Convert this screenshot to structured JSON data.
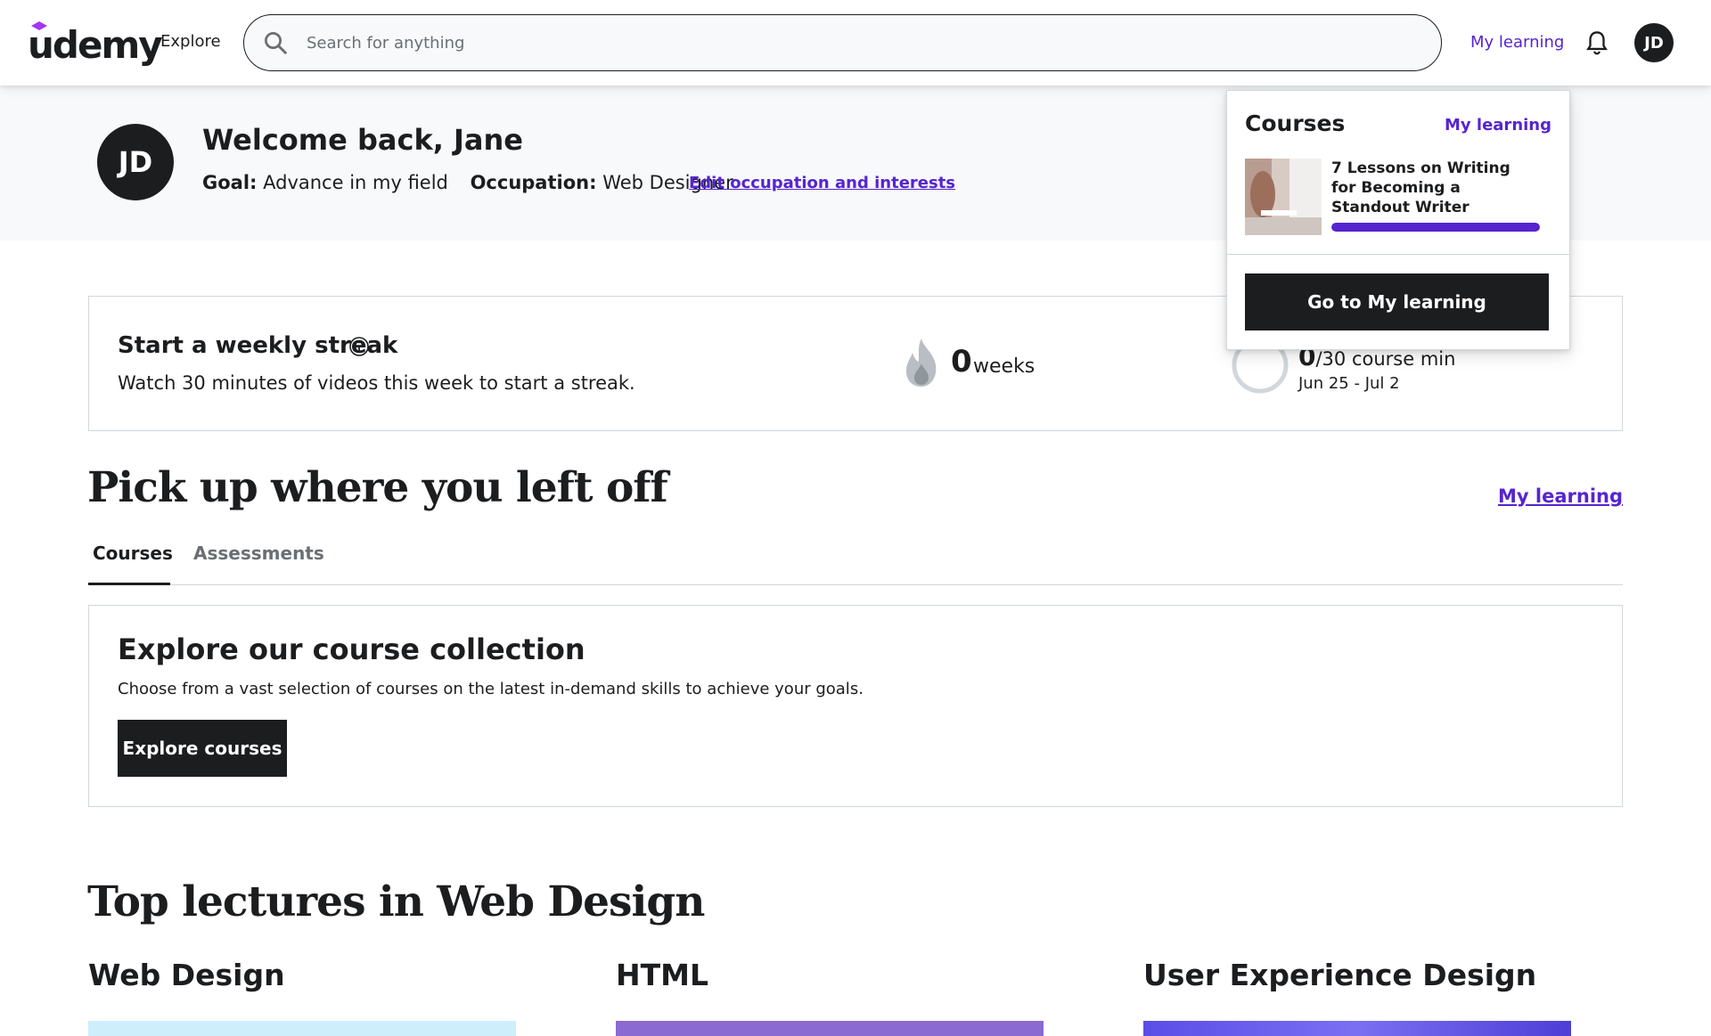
{
  "header": {
    "logo_text": "udemy",
    "explore_label": "Explore",
    "search_placeholder": "Search for anything",
    "my_learning_label": "My learning",
    "avatar_initials": "JD"
  },
  "welcome": {
    "avatar_initials": "JD",
    "title": "Welcome back, Jane",
    "goal_label": "Goal:",
    "goal_value": "Advance in my field",
    "occupation_label": "Occupation:",
    "occupation_value": "Web Designer",
    "edit_link": "Edit occupation and interests"
  },
  "streak": {
    "title": "Start a weekly streak",
    "subtitle": "Watch 30 minutes of videos this week to start a streak.",
    "weeks_count": "0",
    "weeks_label": "weeks",
    "minutes_done": "0",
    "minutes_goal": "/30 course min",
    "date_range": "Jun 25 - Jul 2"
  },
  "dropdown": {
    "title": "Courses",
    "my_learning_link": "My learning",
    "course_title": "7 Lessons on Writing for Becoming a Standout Writer",
    "course_progress": 1.0,
    "button_label": "Go to My learning"
  },
  "pickup": {
    "title": "Pick up where you left off",
    "my_learning_link": "My learning",
    "tabs": [
      "Courses",
      "Assessments"
    ],
    "active_tab": "Courses"
  },
  "collection": {
    "title": "Explore our course collection",
    "subtitle": "Choose from a vast selection of courses on the latest in-demand skills to achieve your goals.",
    "button_label": "Explore courses"
  },
  "top_lectures": {
    "title": "Top lectures in Web Design",
    "columns": [
      "Web Design",
      "HTML",
      "User Experience Design"
    ]
  },
  "colors": {
    "accent": "#5624d0",
    "dark": "#1c1d1f",
    "border": "#d1d7dc",
    "band": "#f7f9fa"
  }
}
